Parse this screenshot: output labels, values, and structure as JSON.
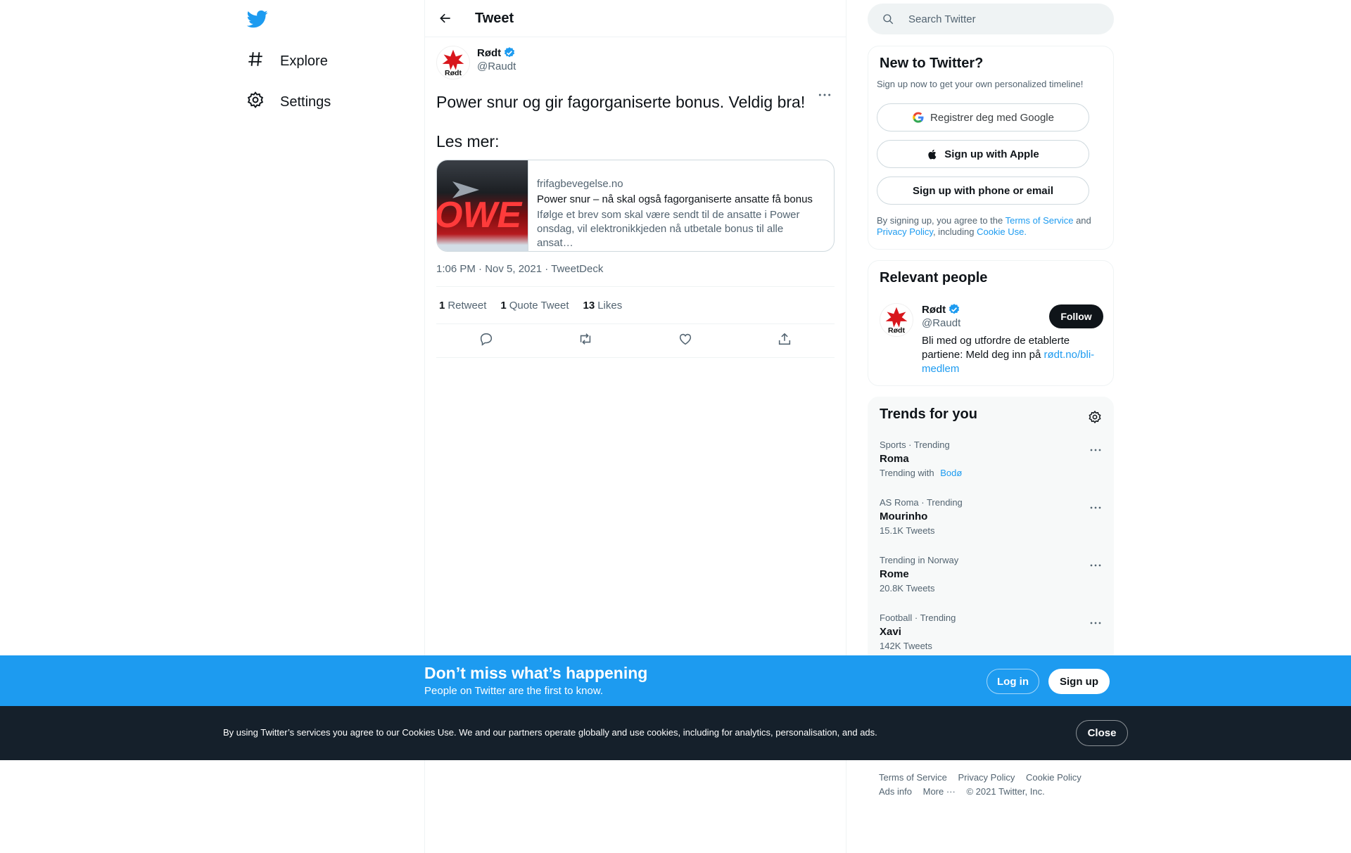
{
  "nav": {
    "explore_label": "Explore",
    "settings_label": "Settings"
  },
  "header": {
    "title": "Tweet"
  },
  "tweet": {
    "author_name": "Rødt",
    "author_handle": "@Raudt",
    "avatar_text": "Rødt",
    "text": "Power snur og gir fagorganiserte bonus. Veldig bra!\n\nLes mer:",
    "card": {
      "domain": "frifagbevegelse.no",
      "title": "Power snur – nå skal også fagorganiserte ansatte få bonus",
      "description": "Ifølge et brev som skal være sendt til de ansatte i Power onsdag, vil elektronikkjeden nå utbetale bonus til alle ansat…",
      "image_text": "OWE"
    },
    "timestamp": "1:06 PM · Nov 5, 2021 · TweetDeck",
    "stats": {
      "retweets_count": "1",
      "retweets_label": "Retweet",
      "quotes_count": "1",
      "quotes_label": "Quote Tweet",
      "likes_count": "13",
      "likes_label": "Likes"
    }
  },
  "search": {
    "placeholder": "Search Twitter"
  },
  "new_to_twitter": {
    "title": "New to Twitter?",
    "subtitle": "Sign up now to get your own personalized timeline!",
    "google_label": "Registrer deg med Google",
    "apple_label": "Sign up with Apple",
    "email_label": "Sign up with phone or email",
    "legal_prefix": "By signing up, you agree to the",
    "terms_link": "Terms of Service",
    "legal_and": "and",
    "privacy_link": "Privacy Policy",
    "legal_including": ", including",
    "cookie_link": "Cookie Use."
  },
  "relevant_people": {
    "title": "Relevant people",
    "name": "Rødt",
    "handle": "@Raudt",
    "bio_text": "Bli med og utfordre de etablerte partiene: Meld deg inn på",
    "bio_link": "rødt.no/bli-medlem",
    "follow_label": "Follow"
  },
  "trends": {
    "title": "Trends for you",
    "items": [
      {
        "meta": "Sports · Trending",
        "name": "Roma",
        "count": "Trending with",
        "link": "Bodø"
      },
      {
        "meta": "AS Roma · Trending",
        "name": "Mourinho",
        "count": "15.1K Tweets"
      },
      {
        "meta": "Trending in Norway",
        "name": "Rome",
        "count": "20.8K Tweets"
      },
      {
        "meta": "Football · Trending",
        "name": "Xavi",
        "count": "142K Tweets"
      }
    ]
  },
  "footer": {
    "terms": "Terms of Service",
    "privacy": "Privacy Policy",
    "cookie": "Cookie Policy",
    "ads": "Ads info",
    "more": "More ···",
    "copyright": "© 2021 Twitter, Inc."
  },
  "banner": {
    "title": "Don’t miss what’s happening",
    "subtitle": "People on Twitter are the first to know.",
    "login_label": "Log in",
    "signup_label": "Sign up"
  },
  "cookie_bar": {
    "text": "By using Twitter’s services you agree to our Cookies Use. We and our partners operate globally and use cookies, including for analytics, personalisation, and ads.",
    "close_label": "Close"
  },
  "colors": {
    "brand": "#1d9bf0",
    "text": "#0f1419",
    "secondary": "#536471",
    "cookie_bg": "#15202b"
  }
}
